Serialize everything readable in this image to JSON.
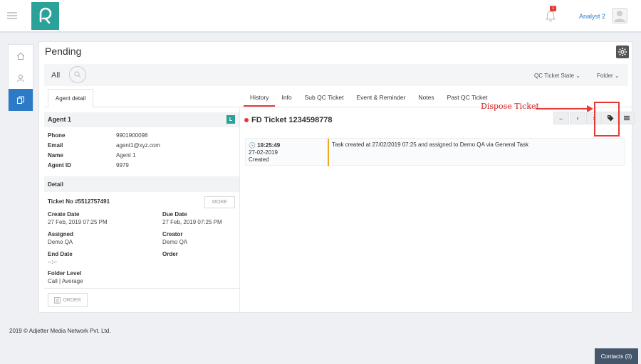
{
  "header": {
    "notification_count": "1",
    "user_name": "Analyst 2"
  },
  "page": {
    "title": "Pending"
  },
  "filter": {
    "all_label": "All",
    "qc_state_label": "QC Ticket State",
    "folder_label": "Folder"
  },
  "agent": {
    "tab_label": "Agent detail",
    "name": "Agent 1",
    "badge": "L",
    "fields": [
      {
        "label": "Phone",
        "value": "9901900098"
      },
      {
        "label": "Email",
        "value": "agent1@xyz.com"
      },
      {
        "label": "Name",
        "value": "Agent 1"
      },
      {
        "label": "Agent ID",
        "value": "9979"
      }
    ]
  },
  "detail": {
    "title": "Detail",
    "ticket_no": "Ticket No #5512757491",
    "more_label": "MORE",
    "create_date_label": "Create Date",
    "create_date": "27 Feb, 2019 07:25 PM",
    "due_date_label": "Due Date",
    "due_date": "27 Feb, 2019 07:25 PM",
    "assigned_label": "Assigned",
    "assigned": "Demo QA",
    "creator_label": "Creator",
    "creator": "Demo QA",
    "end_date_label": "End Date",
    "end_date": "--:--",
    "order_label": "Order",
    "folder_level_label": "Folder Level",
    "folder_level": "Call | Average",
    "order_button": "ORDER"
  },
  "tabs": [
    "History",
    "Info",
    "Sub QC Ticket",
    "Event & Reminder",
    "Notes",
    "Past QC Ticket"
  ],
  "ticket": {
    "title": "FD Ticket 1234598778"
  },
  "annotation": {
    "label": "Dispose Ticket"
  },
  "history": [
    {
      "time": "19:25:49",
      "date": "27-02-2019",
      "status": "Created",
      "message": "Task created at 27/02/2019 07:25 and assigned to Demo QA via General Task"
    }
  ],
  "footer": {
    "copyright": "2019 © Adjetter Media Network Pvt. Ltd.",
    "contacts": "Contacts (0)"
  },
  "colors": {
    "accent": "#2aa199",
    "primary": "#2d7bc6",
    "alert": "#e53935"
  }
}
